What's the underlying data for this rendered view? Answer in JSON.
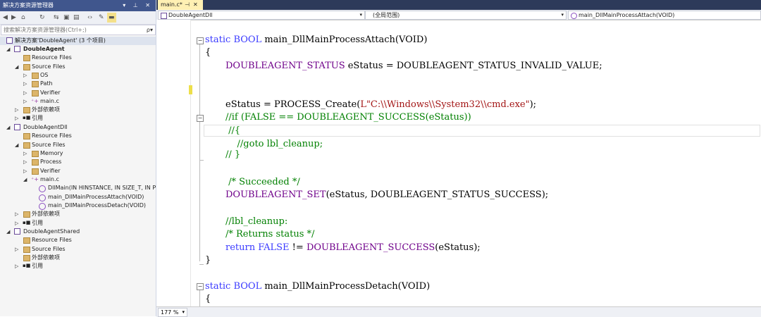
{
  "solution_explorer": {
    "title": "解决方案资源管理器",
    "title_buttons": "▾ ⊥ ✕",
    "search_placeholder": "搜索解决方案资源管理器(Ctrl+;)",
    "search_icon": "ρ▾",
    "toolbar": [
      "back-icon",
      "forward-icon",
      "home-icon",
      "sync-icon",
      "refresh-icon",
      "collapse-all-icon",
      "show-all-files-icon",
      "view-code-icon",
      "properties-icon",
      "preview-icon"
    ],
    "tree": {
      "solution": "解决方案'DoubleAgent' (3 个项目)",
      "p1": {
        "name": "DoubleAgent",
        "resource": "Resource Files",
        "source": "Source Files",
        "folders": [
          "OS",
          "Path",
          "Verifier"
        ],
        "file": "main.c",
        "ext": "外部依赖项",
        "ref": "引用"
      },
      "p2": {
        "name": "DoubleAgentDll",
        "resource": "Resource Files",
        "source": "Source Files",
        "folders": [
          "Memory",
          "Process",
          "Verifier"
        ],
        "file": "main.c",
        "functions": [
          "DllMain(IN HINSTANCE, IN SIZE_T, IN PV",
          "main_DllMainProcessAttach(VOID)",
          "main_DllMainProcessDetach(VOID)"
        ],
        "ext": "外部依赖项",
        "ref": "引用"
      },
      "p3": {
        "name": "DoubleAgentShared",
        "resource": "Resource Files",
        "source": "Source Files",
        "ext": "外部依赖项",
        "ref": "引用"
      }
    }
  },
  "editor": {
    "tab": {
      "label": "main.c*",
      "pin": "⊣",
      "close": "✕"
    },
    "nav": {
      "project": "DoubleAgentDll",
      "scope": "(全局范围)",
      "member": "main_DllMainProcessAttach(VOID)"
    },
    "zoom": "177 %",
    "code": {
      "l1_kw": "static",
      "l1_type": "BOOL",
      "l1_rest": " main_DllMainProcessAttach(VOID)",
      "l2": "{",
      "l3_t": "DOUBLEAGENT_STATUS",
      "l3_rest": " eStatus = ",
      "l3_m": "DOUBLEAGENT_STATUS_INVALID_VALUE",
      "l3_end": ";",
      "l5_a": "eStatus = PROCESS_Create(",
      "l5_s": "L\"C:\\\\Windows\\\\System32\\\\cmd.exe\"",
      "l5_e": ");",
      "l6": "//if (FALSE == DOUBLEAGENT_SUCCESS(eStatus))",
      "l7": " //{",
      "l8": "    //goto lbl_cleanup;",
      "l9": "// }",
      "l11": " /* Succeeded */",
      "l12_m": "DOUBLEAGENT_SET",
      "l12_r": "(eStatus, ",
      "l12_m2": "DOUBLEAGENT_STATUS_SUCCESS",
      "l12_e": ");",
      "l14": "//lbl_cleanup:",
      "l15": "/* Returns status */",
      "l16_kw": "return",
      "l16_f": " FALSE",
      "l16_r": " != ",
      "l16_m": "DOUBLEAGENT_SUCCESS",
      "l16_e": "(eStatus);",
      "l17": "}",
      "l19_kw": "static",
      "l19_type": "BOOL",
      "l19_rest": " main_DllMainProcessDetach(VOID)",
      "l20": "{"
    }
  },
  "colors": {
    "title_bar": "#40568d",
    "tab_active": "#fff0b3",
    "keyword": "#3a3aff",
    "macro": "#6f008a",
    "comment": "#008000",
    "string": "#a31515",
    "change_marker": "#eddf4a"
  }
}
